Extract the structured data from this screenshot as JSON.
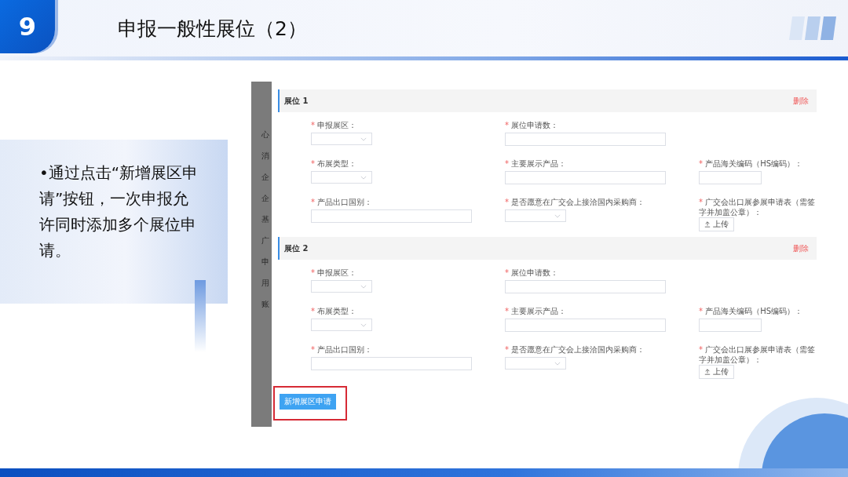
{
  "slide": {
    "number": "9",
    "title": "申报一般性展位（2）",
    "bullet": "•通过点击“新增展区申请”按钮，一次申报允许同时添加多个展位申请。"
  },
  "screenshot": {
    "sidebar_items": [
      "心",
      "消",
      "企",
      "企",
      "基",
      "广",
      "申",
      "用",
      "账"
    ],
    "booths": [
      {
        "title": "展位 1",
        "delete": "删除",
        "rows": [
          [
            {
              "kind": "select",
              "mark": "*",
              "label": "申报展区："
            },
            {
              "kind": "input",
              "mark": "*",
              "label": "展位申请数："
            }
          ],
          [
            {
              "kind": "select",
              "mark": "*",
              "label": "布展类型："
            },
            {
              "kind": "input",
              "mark": "*",
              "label": "主要展示产品："
            },
            {
              "kind": "input",
              "mark": "*",
              "label": "产品海关编码（HS编码）："
            }
          ],
          [
            {
              "kind": "input",
              "mark": "*",
              "label": "产品出口国别："
            },
            {
              "kind": "select",
              "mark": "*",
              "label": "是否愿意在广交会上接洽国内采购商："
            },
            {
              "kind": "upload",
              "mark": "*",
              "label": "广交会出口展参展申请表（需签字并加盖公章）：",
              "button": "上传"
            }
          ]
        ]
      },
      {
        "title": "展位 2",
        "delete": "删除",
        "rows": [
          [
            {
              "kind": "select",
              "mark": "*",
              "label": "申报展区："
            },
            {
              "kind": "input",
              "mark": "*",
              "label": "展位申请数："
            }
          ],
          [
            {
              "kind": "select",
              "mark": "*",
              "label": "布展类型："
            },
            {
              "kind": "input",
              "mark": "*",
              "label": "主要展示产品："
            },
            {
              "kind": "input",
              "mark": "*",
              "label": "产品海关编码（HS编码）："
            }
          ],
          [
            {
              "kind": "input",
              "mark": "*",
              "label": "产品出口国别："
            },
            {
              "kind": "select",
              "mark": "*",
              "label": "是否愿意在广交会上接洽国内采购商："
            },
            {
              "kind": "upload",
              "mark": "*",
              "label": "广交会出口展参展申请表（需签字并加盖公章）：",
              "button": "上传"
            }
          ]
        ]
      }
    ],
    "add_button": {
      "label": "新增展区申请",
      "highlighted": true
    }
  }
}
